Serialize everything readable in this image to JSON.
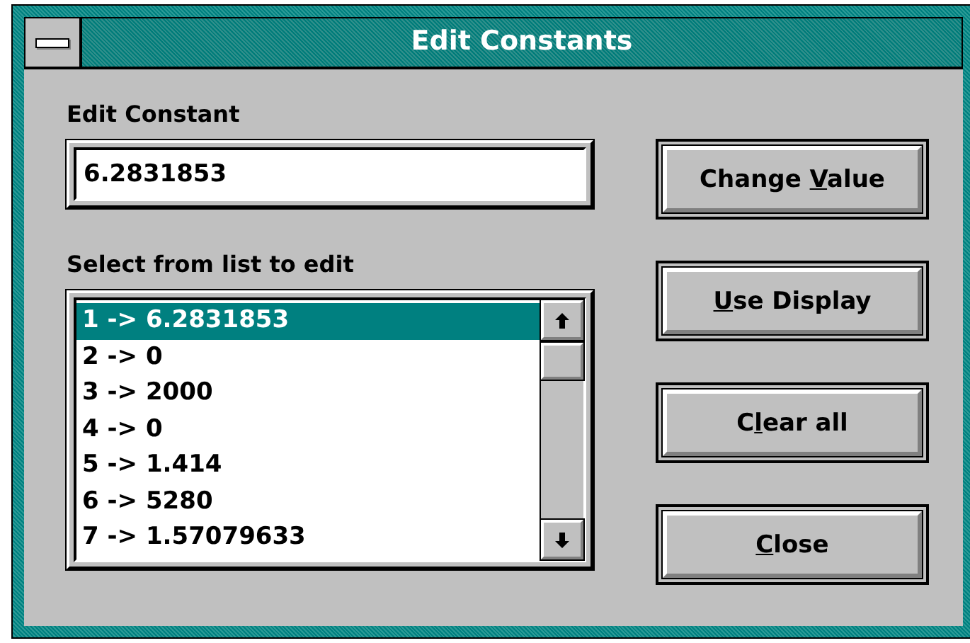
{
  "window": {
    "title": "Edit Constants"
  },
  "edit_field": {
    "label": "Edit Constant",
    "value": "6.2831853"
  },
  "list": {
    "label": "Select from list to edit",
    "items": [
      {
        "text": "1 -> 6.2831853",
        "selected": true
      },
      {
        "text": "2 -> 0",
        "selected": false
      },
      {
        "text": "3 -> 2000",
        "selected": false
      },
      {
        "text": "4 -> 0",
        "selected": false
      },
      {
        "text": "5 -> 1.414",
        "selected": false
      },
      {
        "text": "6 -> 5280",
        "selected": false
      },
      {
        "text": "7 -> 1.57079633",
        "selected": false
      }
    ]
  },
  "buttons": [
    {
      "before": "Change ",
      "access_key": "V",
      "after": "alue"
    },
    {
      "access_key": "U",
      "after": "se Display"
    },
    {
      "before": "C",
      "access_key": "l",
      "after": "ear all"
    },
    {
      "access_key": "C",
      "after": "lose"
    }
  ]
}
